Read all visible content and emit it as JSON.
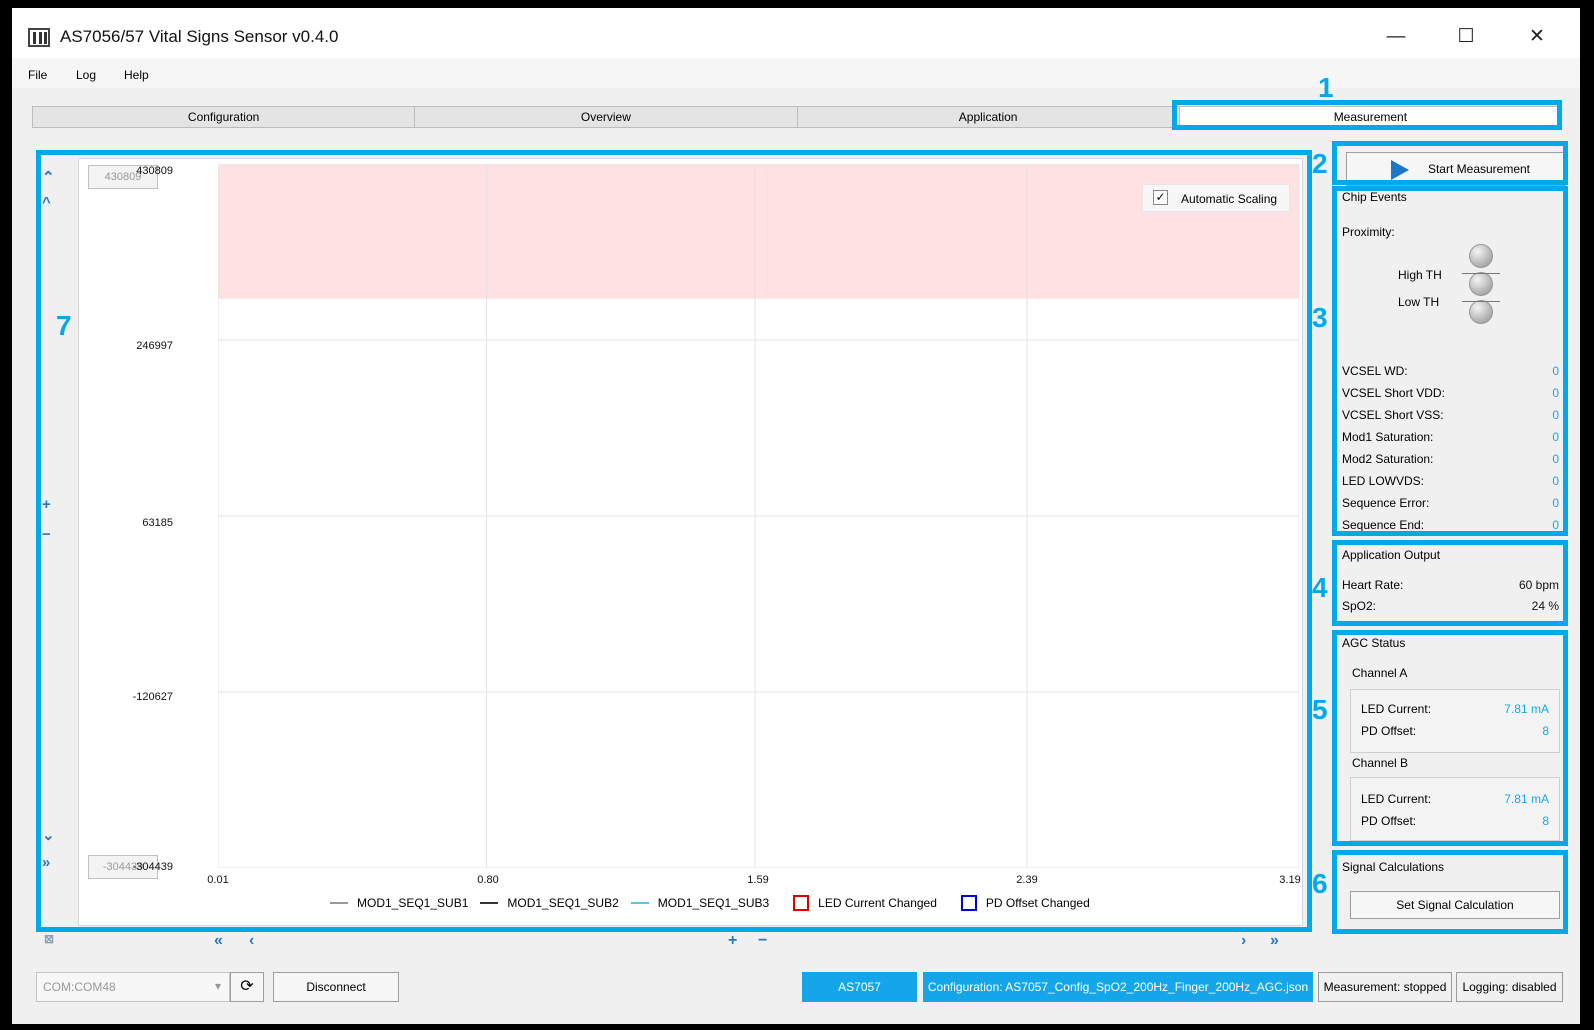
{
  "window": {
    "title": "AS7056/57 Vital Signs Sensor  v0.4.0",
    "controls": [
      "—",
      "☐",
      "✕"
    ]
  },
  "menu": [
    "File",
    "Log",
    "Help"
  ],
  "tabs": [
    {
      "label": "Configuration"
    },
    {
      "label": "Overview"
    },
    {
      "label": "Application"
    },
    {
      "label": "Measurement",
      "active": true
    }
  ],
  "callouts": [
    "1",
    "2",
    "3",
    "4",
    "5",
    "6",
    "7"
  ],
  "plot": {
    "range_top": "430809",
    "range_bottom": "-304439",
    "automatic_scaling_label": "Automatic Scaling",
    "automatic_scaling_checked": true,
    "legend": [
      "MOD1_SEQ1_SUB1",
      "MOD1_SEQ1_SUB2",
      "MOD1_SEQ1_SUB3",
      "LED Current Changed",
      "PD Offset Changed"
    ]
  },
  "chart_data": {
    "type": "line",
    "y_ticks": [
      "430809",
      "246997",
      "63185",
      "-120627",
      "-304439"
    ],
    "x_ticks": [
      "0.01",
      "0.80",
      "1.59",
      "2.39",
      "3.19"
    ],
    "ylim": [
      -304439,
      430809
    ],
    "xlim": [
      0.01,
      3.19
    ],
    "grid": true,
    "legend_placement": "bottom",
    "series": [
      {
        "name": "MOD1_SEQ1_SUB1",
        "values": []
      },
      {
        "name": "MOD1_SEQ1_SUB2",
        "values": []
      },
      {
        "name": "MOD1_SEQ1_SUB3",
        "values": []
      }
    ],
    "highlight_band": [
      290000,
      430809
    ]
  },
  "measurement": {
    "start_label": "Start Measurement"
  },
  "chip_events": {
    "title": "Chip Events",
    "proximity_label": "Proximity:",
    "high_th": "High TH",
    "low_th": "Low TH",
    "items": [
      {
        "label": "VCSEL WD:",
        "value": "0"
      },
      {
        "label": "VCSEL Short VDD:",
        "value": "0"
      },
      {
        "label": "VCSEL Short VSS:",
        "value": "0"
      },
      {
        "label": "Mod1 Saturation:",
        "value": "0"
      },
      {
        "label": "Mod2 Saturation:",
        "value": "0"
      },
      {
        "label": "LED LOWVDS:",
        "value": "0"
      },
      {
        "label": "Sequence Error:",
        "value": "0"
      },
      {
        "label": "Sequence End:",
        "value": "0"
      }
    ]
  },
  "application_output": {
    "title": "Application Output",
    "heart_rate_label": "Heart Rate:",
    "heart_rate_value": "60 bpm",
    "spo2_label": "SpO2:",
    "spo2_value": "24 %"
  },
  "agc": {
    "title": "AGC Status",
    "channel_a": "Channel A",
    "channel_b": "Channel B",
    "led_label": "LED Current:",
    "pd_label": "PD Offset:",
    "a_led": "7.81 mA",
    "a_pd": "8",
    "b_led": "7.81 mA",
    "b_pd": "8"
  },
  "signal_calc": {
    "title": "Signal Calculations",
    "button": "Set Signal Calculation"
  },
  "statusbar": {
    "com": "COM:COM48",
    "disconnect": "Disconnect",
    "device": "AS7057",
    "configuration": "Configuration: AS7057_Config_SpO2_200Hz_Finger_200Hz_AGC.json",
    "measurement": "Measurement: stopped",
    "logging": "Logging: disabled"
  },
  "colors": {
    "accent": "#00aaea",
    "status_blue": "#15a6ea",
    "highlight_band": "#ffe0e3",
    "series1": "#999999",
    "series2": "#333333",
    "series3": "#50c8f0",
    "led_changed": "#e00000",
    "pd_changed": "#0000d8"
  },
  "icons": [
    "app-icon",
    "minimize-icon",
    "maximize-icon",
    "close-icon",
    "double-up-icon",
    "up-icon",
    "plus-icon",
    "minus-icon",
    "down-icon",
    "double-down-icon",
    "fit-icon",
    "double-left-icon",
    "left-icon",
    "right-icon",
    "double-right-icon",
    "refresh-icon",
    "play-icon"
  ]
}
